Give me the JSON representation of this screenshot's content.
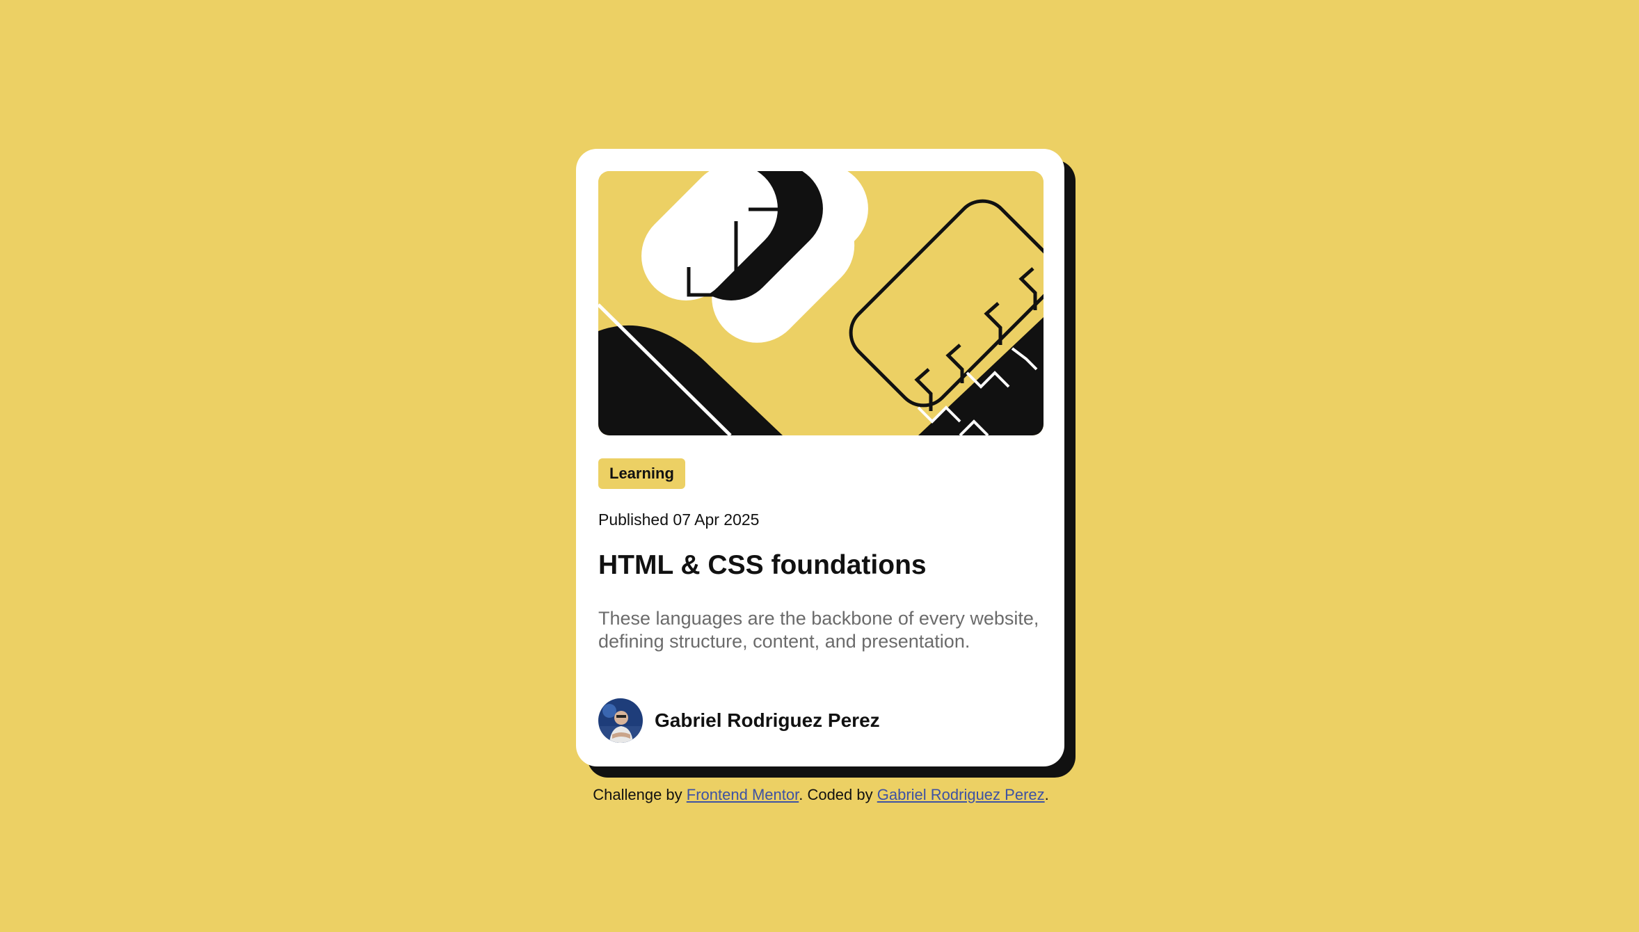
{
  "page": {
    "background_color": "#ecd064"
  },
  "card": {
    "hero_image": "illustration-article",
    "tag": "Learning",
    "published": "Published 07 Apr 2025",
    "title": "HTML & CSS foundations",
    "description": "These languages are the backbone of every website, defining structure, content, and presentation.",
    "author": {
      "avatar": "author-avatar",
      "name": "Gabriel Rodriguez Perez"
    }
  },
  "attribution": {
    "prefix": "Challenge by ",
    "link1": "Frontend Mentor",
    "middle": ". Coded by ",
    "link2": "Gabriel Rodriguez Perez",
    "suffix": "."
  },
  "colors": {
    "accent": "#ecd064",
    "text": "#111111",
    "muted": "#6b6b6b",
    "link": "#3e52a3"
  }
}
